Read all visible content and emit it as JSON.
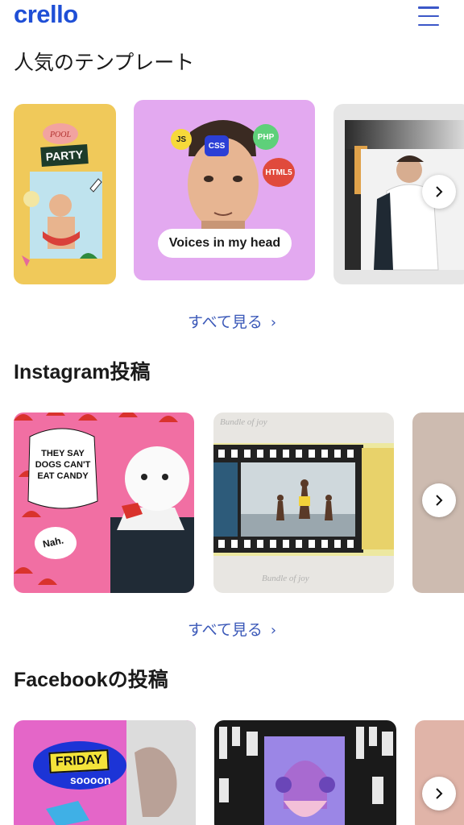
{
  "header": {
    "logo": "crello",
    "menu_icon": "hamburger-menu-icon",
    "brand_color": "#1f4fd6"
  },
  "sections": [
    {
      "title": "人気のテンプレート",
      "see_all": "すべて見る",
      "cards": [
        {
          "name": "pool-party-story",
          "texts": [
            "POOL",
            "PARTY"
          ]
        },
        {
          "name": "voices-in-my-head",
          "texts": [
            "Voices in my head",
            "JS",
            "CSS",
            "PHP",
            "HTML5"
          ]
        },
        {
          "name": "business-man-portrait",
          "texts": []
        }
      ]
    },
    {
      "title": "Instagram投稿",
      "see_all": "すべて見る",
      "cards": [
        {
          "name": "dogs-candy-post",
          "texts": [
            "THEY SAY DOGS CAN'T EAT CANDY",
            "Nah."
          ]
        },
        {
          "name": "bundle-of-joy-post",
          "texts": [
            "Bundle of joy"
          ]
        },
        {
          "name": "partial-card",
          "texts": []
        }
      ]
    },
    {
      "title": "Facebookの投稿",
      "see_all": "",
      "cards": [
        {
          "name": "friday-post",
          "texts": [
            "FRIDAY",
            "soooon"
          ]
        },
        {
          "name": "headphones-post",
          "texts": []
        },
        {
          "name": "partial-card",
          "texts": []
        }
      ]
    }
  ],
  "accent_color": "#3a58b8"
}
